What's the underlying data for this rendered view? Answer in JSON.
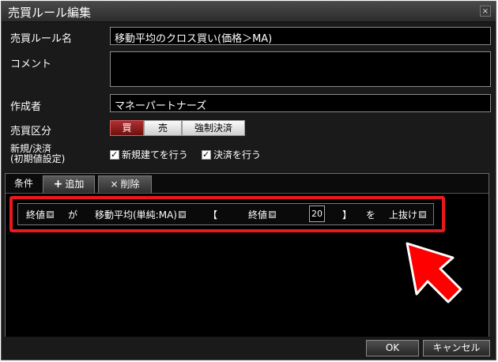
{
  "window": {
    "title": "売買ルール編集",
    "close_glyph": "×"
  },
  "form": {
    "rule_name_label": "売買ルール名",
    "rule_name_value": "移動平均のクロス買い(価格＞MA)",
    "comment_label": "コメント",
    "comment_value": "",
    "author_label": "作成者",
    "author_value": "マネーパートナーズ",
    "trade_type_label": "売買区分",
    "trade_type_options": [
      "買",
      "売",
      "強制決済"
    ],
    "trade_type_selected": "買",
    "new_settle_label": "新規/決済\n(初期値設定)",
    "checkbox_new": "新規建てを行う",
    "checkbox_settle": "決済を行う"
  },
  "tabs": {
    "condition_label": "条件",
    "add_label": "追加",
    "delete_label": "削除",
    "add_glyph": "+",
    "delete_glyph": "×"
  },
  "condition": {
    "left_operand": "終値",
    "particle_ga": "が",
    "indicator": "移動平均(単純:MA)",
    "bracket_open": "【",
    "inner_operand": "終値",
    "period": "20",
    "bracket_close": "】",
    "particle_wo": "を",
    "operator": "上抜け"
  },
  "buttons": {
    "ok": "OK",
    "cancel": "キャンセル"
  },
  "colors": {
    "highlight": "#e8191e",
    "active_segment": "#8b1a1a",
    "background": "#1a1a1a"
  }
}
